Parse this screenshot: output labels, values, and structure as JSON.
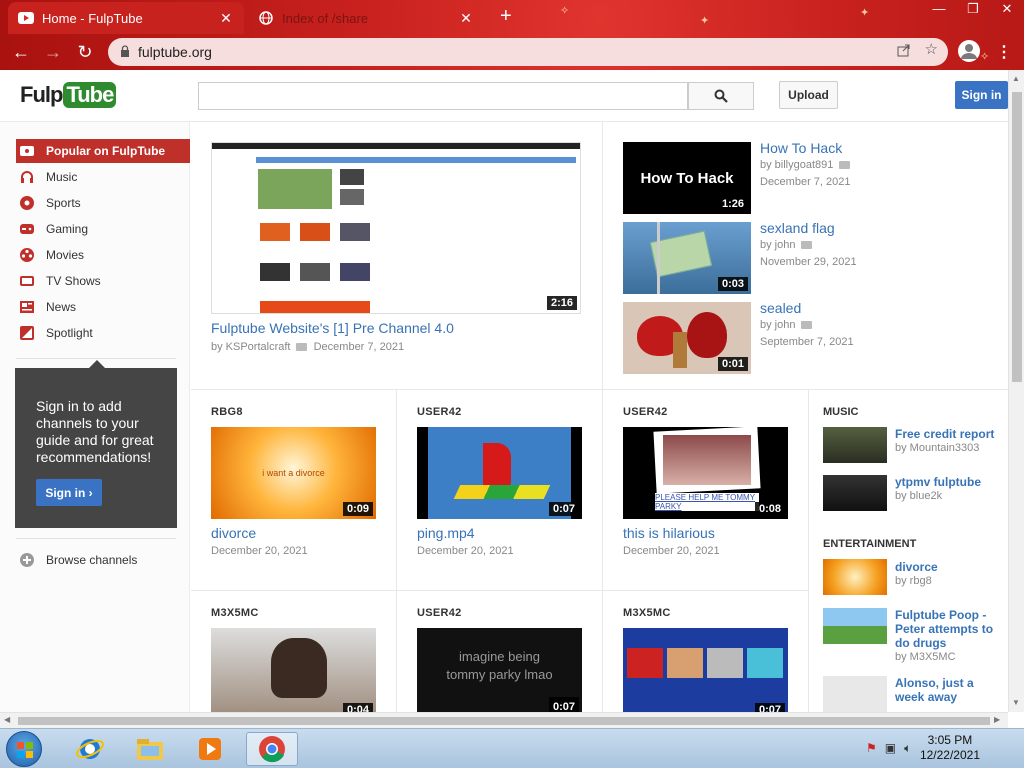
{
  "browser": {
    "tabs": [
      {
        "title": "Home - FulpTube",
        "active": true
      },
      {
        "title": "Index of /share",
        "active": false
      }
    ],
    "url": "fulptube.org"
  },
  "site": {
    "logo_left": "Fulp",
    "logo_right": "Tube",
    "search_placeholder": "",
    "upload_label": "Upload",
    "signin_label": "Sign in"
  },
  "guide": {
    "items": [
      {
        "label": "Popular on FulpTube",
        "icon": "popular-icon"
      },
      {
        "label": "Music",
        "icon": "headphones-icon"
      },
      {
        "label": "Sports",
        "icon": "ball-icon"
      },
      {
        "label": "Gaming",
        "icon": "gamepad-icon"
      },
      {
        "label": "Movies",
        "icon": "film-reel-icon"
      },
      {
        "label": "TV Shows",
        "icon": "tv-icon"
      },
      {
        "label": "News",
        "icon": "newspaper-icon"
      },
      {
        "label": "Spotlight",
        "icon": "spotlight-icon"
      }
    ],
    "promo_text": "Sign in to add channels to your guide and for great recommendations!",
    "promo_button": "Sign in ›",
    "browse_label": "Browse channels"
  },
  "featured": {
    "title": "Fulptube Website's [1] Pre Channel 4.0",
    "by": "by KSPortalcraft",
    "date": "December 7, 2021",
    "duration": "2:16"
  },
  "top_list": [
    {
      "title": "How To Hack",
      "by": "by billygoat891",
      "date": "December 7, 2021",
      "duration": "1:26",
      "thumb_text": "How To Hack"
    },
    {
      "title": "sexland flag",
      "by": "by john",
      "date": "November 29, 2021",
      "duration": "0:03"
    },
    {
      "title": "sealed",
      "by": "by john",
      "date": "September 7, 2021",
      "duration": "0:01"
    }
  ],
  "grid_row1": [
    {
      "channel": "RBG8",
      "title": "divorce",
      "date": "December 20, 2021",
      "duration": "0:09",
      "thumb_text": "i want a divorce"
    },
    {
      "channel": "USER42",
      "title": "ping.mp4",
      "date": "December 20, 2021",
      "duration": "0:07"
    },
    {
      "channel": "USER42",
      "title": "this is hilarious",
      "date": "December 20, 2021",
      "duration": "0:08",
      "thumb_text": "PLEASE HELP ME TOMMY PARKY"
    }
  ],
  "grid_row2": [
    {
      "channel": "M3X5MC",
      "duration": "0:04"
    },
    {
      "channel": "USER42",
      "duration": "0:07",
      "thumb_text": "imagine being tommy parky lmao"
    },
    {
      "channel": "M3X5MC",
      "duration": "0:07"
    }
  ],
  "sidebar_right": {
    "music_header": "MUSIC",
    "music": [
      {
        "title": "Free credit report",
        "by": "by Mountain3303"
      },
      {
        "title": "ytpmv fulptube",
        "by": "by blue2k"
      }
    ],
    "entertainment_header": "ENTERTAINMENT",
    "entertainment": [
      {
        "title": "divorce",
        "by": "by rbg8"
      },
      {
        "title": "Fulptube Poop - Peter attempts to do drugs",
        "by": "by M3X5MC"
      },
      {
        "title": "Alonso, just a week away",
        "by": ""
      }
    ]
  },
  "taskbar": {
    "time": "3:05 PM",
    "date": "12/22/2021"
  },
  "colors": {
    "accent_red": "#c0302b",
    "link_blue": "#3873b6",
    "button_blue": "#3a73c4"
  }
}
